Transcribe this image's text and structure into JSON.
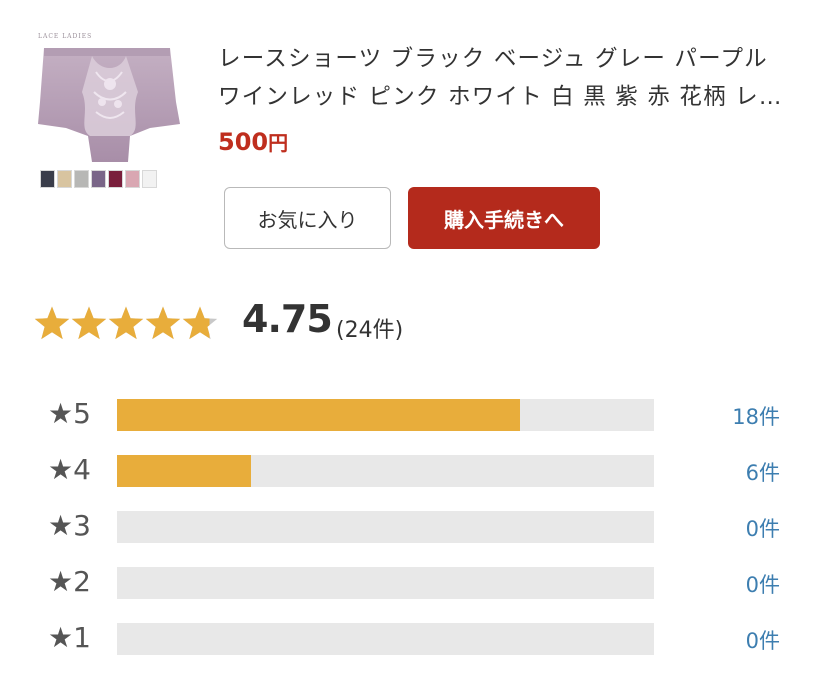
{
  "product": {
    "brand_text": "LACE LADIES",
    "image_icon": "lace-shorts-product-photo",
    "swatch_colors": [
      "#3a3d4a",
      "#d8c4a0",
      "#b7b7b5",
      "#7a6688",
      "#7a1f3c",
      "#d9a7b2",
      "#f2f2f2"
    ],
    "title": "レースショーツ ブラック ベージュ グレー パープル ワインレッド ピンク ホワイト 白 黒 紫 赤 花柄 レース",
    "price_value": "500",
    "price_unit": "円"
  },
  "buttons": {
    "favorite_label": "お気に入り",
    "checkout_label": "購入手続きへ"
  },
  "rating": {
    "average": 4.75,
    "average_text": "4.75",
    "count_text": "(24件)",
    "total": 24,
    "star_color": "#e8ad3b",
    "empty_star_color": "#c8c8c8",
    "distribution": [
      {
        "label": "★5",
        "count": 18,
        "count_text": "18件"
      },
      {
        "label": "★4",
        "count": 6,
        "count_text": "6件"
      },
      {
        "label": "★3",
        "count": 0,
        "count_text": "0件"
      },
      {
        "label": "★2",
        "count": 0,
        "count_text": "0件"
      },
      {
        "label": "★1",
        "count": 0,
        "count_text": "0件"
      }
    ]
  },
  "colors": {
    "price": "#bf2e1e",
    "checkout_button": "#b42a1c",
    "bar_fill": "#e8ad3b",
    "bar_track": "#e8e8e8",
    "count_link": "#3d7eb0"
  }
}
